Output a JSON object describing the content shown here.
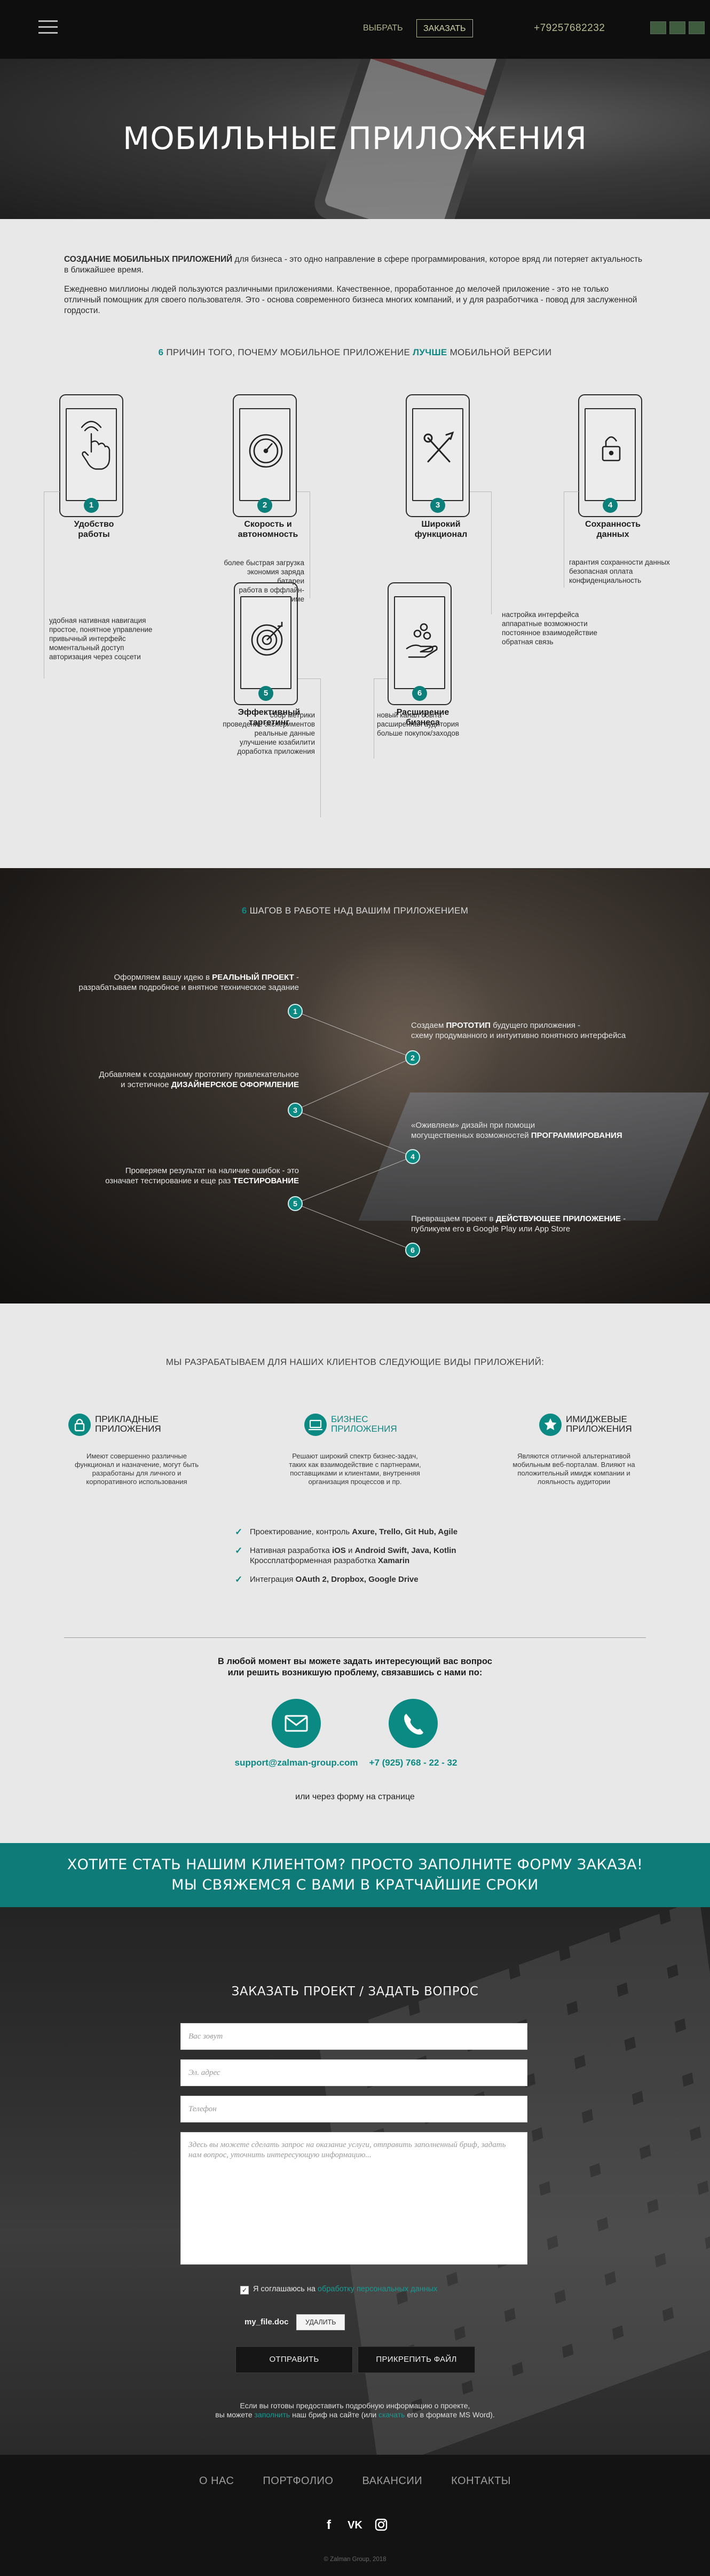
{
  "header": {
    "choose": "ВЫБРАТЬ",
    "order": "ЗАКАЗАТЬ",
    "phone": "+79257682232",
    "langs": [
      "",
      "",
      ""
    ]
  },
  "hero": {
    "title": "МОБИЛЬНЫЕ ПРИЛОЖЕНИЯ"
  },
  "intro": {
    "p1_bold": "СОЗДАНИЕ МОБИЛЬНЫХ ПРИЛОЖЕНИЙ",
    "p1_rest": " для бизнеса - это одно направление в сфере программирования, которое вряд ли потеряет актуальность в ближайшее время.",
    "p2": "Ежедневно миллионы людей пользуются различными приложениями. Качественное, проработанное до мелочей приложение - это не только отличный помощник для своего пользователя. Это - основа современного бизнеса многих компаний, и у для разработчика - повод для заслуженной гордости."
  },
  "reasons": {
    "head_num": "6",
    "head_a": " ПРИЧИН ТОГО, ПОЧЕМУ МОБИЛЬНОЕ ПРИЛОЖЕНИЕ ",
    "head_best": "ЛУЧШЕ",
    "head_b": " МОБИЛЬНОЙ ВЕРСИИ",
    "items": [
      {
        "num": "1",
        "icon": "touch-icon",
        "title": "Удобство\nработы",
        "desc": "удобная нативная навигация\nпростое, понятное управление\nпривычный интерфейс\nмоментальный доступ\nавторизация через соцсети"
      },
      {
        "num": "2",
        "icon": "speedometer-icon",
        "title": "Скорость и\nавтономность",
        "desc": "более быстрая загрузка\nэкономия заряда батареи\nработа в оффлайн-режиме"
      },
      {
        "num": "3",
        "icon": "tools-icon",
        "title": "Широкий\nфункционал",
        "desc": "настройка интерфейса\nаппаратные возможности\nпостоянное взаимодействие\nобратная связь"
      },
      {
        "num": "4",
        "icon": "lock-icon",
        "title": "Сохранность\nданных",
        "desc": "гарантия сохранности данных\nбезопасная оплата\nконфиденциальность"
      },
      {
        "num": "5",
        "icon": "target-icon",
        "title": "Эффективный\nтаргетинг",
        "desc": "сбор метрики\nпроведение экспериментов\nреальные данные\nулучшение юзабилити\nдоработка приложения"
      },
      {
        "num": "6",
        "icon": "hand-coins-icon",
        "title": "Расширение\nбизнеса",
        "desc": "новый канал сбыта\nрасширенная аудитория\nбольше покупок/заходов"
      }
    ]
  },
  "steps": {
    "head_num": "6",
    "head_rest": " ШАГОВ В РАБОТЕ НАД ВАШИМ ПРИЛОЖЕНИЕМ",
    "items": [
      {
        "num": "1",
        "a": "Оформляем вашу идею в ",
        "b": "РЕАЛЬНЫЙ ПРОЕКТ",
        "c": " -\nразрабатываем подробное и внятное техническое задание"
      },
      {
        "num": "2",
        "a": "Создаем ",
        "b": "ПРОТОТИП",
        "c": " будущего приложения -\nсхему продуманного и интуитивно понятного интерфейса"
      },
      {
        "num": "3",
        "a": "Добавляем к созданному прототипу привлекательное\nи эстетичное ",
        "b": "ДИЗАЙНЕРСКОЕ ОФОРМЛЕНИЕ",
        "c": ""
      },
      {
        "num": "4",
        "a": "«Оживляем» дизайн при помощи\nмогущественных возможностей ",
        "b": "ПРОГРАММИРОВАНИЯ",
        "c": ""
      },
      {
        "num": "5",
        "a": "Проверяем результат на наличие ошибок - это\nозначает тестирование и еще раз ",
        "b": "ТЕСТИРОВАНИЕ",
        "c": ""
      },
      {
        "num": "6",
        "a": "Превращаем проект в ",
        "b": "ДЕЙСТВУЮЩЕЕ ПРИЛОЖЕНИЕ",
        "c": " -\nпубликуем его в Google Play или App Store"
      }
    ]
  },
  "types": {
    "head": "МЫ РАЗРАБАТЫВАЕМ ДЛЯ НАШИХ КЛИЕНТОВ СЛЕДУЮЩИЕ ВИДЫ ПРИЛОЖЕНИЙ:",
    "items": [
      {
        "icon": "lock-icon",
        "title": "ПРИКЛАДНЫЕ\nПРИЛОЖЕНИЯ",
        "desc": "Имеют совершенно различные\nфункционал и назначение, могут быть\nразработаны для личного и\nкорпоративного использования"
      },
      {
        "icon": "laptop-icon",
        "title": "БИЗНЕС\nПРИЛОЖЕНИЯ",
        "desc": "Решают широкий спектр бизнес-задач,\nтаких как взаимодействие с партнерами,\nпоставщиками и клиентами, внутренняя\nорганизация процессов и пр."
      },
      {
        "icon": "star-badge-icon",
        "title": "ИМИДЖЕВЫЕ\nПРИЛОЖЕНИЯ",
        "desc": "Являются отличной альтернативой\nмобильным веб-порталам. Влияют на\nположительный имидж компании и\nлояльность аудитории"
      }
    ],
    "tech": [
      {
        "a": "Проектирование, контроль ",
        "b": "Axure, Trello, Git Hub, Agile"
      },
      {
        "a": "Нативная разработка ",
        "b": "iOS",
        "a2": " и ",
        "b2": "Android Swift, Java, Kotlin",
        "line2a": "Кроссплатформенная разработка ",
        "line2b": "Xamarin"
      },
      {
        "a": "Интеграция ",
        "b": "OAuth 2, Dropbox, Google Drive"
      }
    ]
  },
  "contact": {
    "question": "В любой момент вы можете задать интересующий вас вопрос\nили решить возникшую проблему, связавшись с нами по:",
    "email": "support@zalman-group.com",
    "phone": "+7 (925) 768 - 22 - 32",
    "or": "или через форму на странице"
  },
  "cta": {
    "line1": "ХОТИТЕ СТАТЬ НАШИМ КЛИЕНТОМ? ПРОСТО ЗАПОЛНИТЕ ФОРМУ ЗАКАЗА!",
    "line2": "МЫ СВЯЖЕМСЯ С ВАМИ В КРАТЧАЙШИЕ СРОКИ"
  },
  "form": {
    "title": "ЗАКАЗАТЬ ПРОЕКТ / ЗАДАТЬ ВОПРОС",
    "name_ph": "Вас зовут",
    "email_ph": "Эл. адрес",
    "phone_ph": "Телефон",
    "message_ph": "Здесь вы можете сделать запрос на оказание услуги, отправить заполненный бриф, задать нам вопрос, уточнить интересующую информацию...",
    "agree_text": "Я соглашаюсь на ",
    "agree_link": "обработку персональных данных",
    "file_name": "my_file.doc",
    "delete": "УДАЛИТЬ",
    "send": "ОТПРАВИТЬ",
    "attach": "ПРИКРЕПИТЬ ФАЙЛ",
    "note1": "Если вы готовы предоставить подробную информацию о проекте,",
    "note2a": "вы можете ",
    "note2_link1": "заполнить",
    "note2b": " наш бриф на сайте (или ",
    "note2_link2": "скачать",
    "note2c": " его в формате MS Word)."
  },
  "footer": {
    "nav": [
      "О НАС",
      "ПОРТФОЛИО",
      "ВАКАНСИИ",
      "КОНТАКТЫ"
    ],
    "copyright": "© Zalman Group, 2018"
  },
  "colors": {
    "accent": "#0b8a84",
    "cta_bg": "#0e7b79",
    "header_bg": "#0e0e0e",
    "gold": "#b0b28c"
  }
}
